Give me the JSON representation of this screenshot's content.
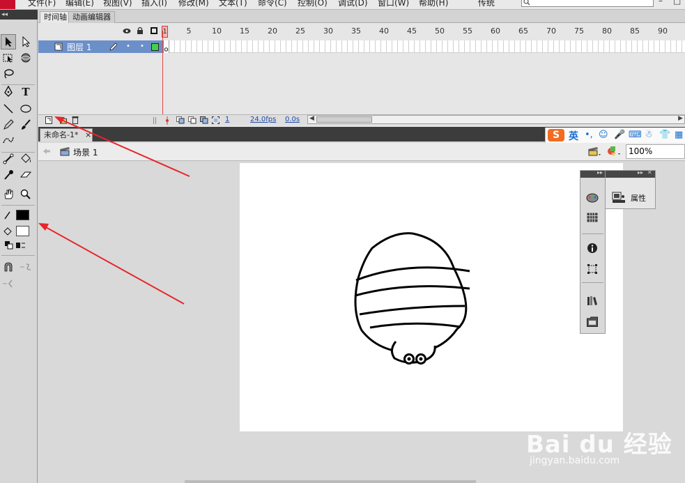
{
  "menu": {
    "items": [
      "文件(F)",
      "编辑(E)",
      "视图(V)",
      "插入(I)",
      "修改(M)",
      "文本(T)",
      "命令(C)",
      "控制(O)",
      "调试(D)",
      "窗口(W)",
      "帮助(H)"
    ],
    "workspace": "传统",
    "window_buttons": [
      "–",
      "□"
    ]
  },
  "tools_panel": {
    "collapse_glyph": "◂◂"
  },
  "timeline": {
    "tabs": [
      "时间轴",
      "动画编辑器"
    ],
    "layer_name": "图层 1",
    "frame_numbers": [
      "5",
      "10",
      "15",
      "20",
      "25",
      "30",
      "35",
      "40",
      "45",
      "50",
      "55",
      "60",
      "65",
      "70",
      "75",
      "80",
      "85",
      "90"
    ],
    "first_frame": "1",
    "current_frame": "1",
    "fps": "24.0fps",
    "time": "0.0s"
  },
  "document": {
    "tab_title": "未命名-1*",
    "tab_close": "×",
    "scene": "场景 1",
    "zoom": "100%"
  },
  "ime": {
    "logo": "S",
    "lang": "英",
    "symbols": [
      "•,",
      "☺",
      "🎤",
      "⌨",
      "☃",
      "👕",
      "▦"
    ]
  },
  "panels": {
    "properties_label": "属性"
  },
  "watermark": {
    "brand": "Bai du 经验",
    "url": "jingyan.baidu.com"
  },
  "colors": {
    "annotation_arrow": "#e8252b",
    "layer_highlight": "#6b8fc9",
    "playhead": "#e24444",
    "stroke_color": "#000000",
    "fill_color": "#ffffff"
  },
  "icons": [
    "selection-tool-icon",
    "subselection-tool-icon",
    "free-transform-icon",
    "3d-rotation-icon",
    "lasso-icon",
    "pen-tool-icon",
    "text-tool-icon",
    "line-tool-icon",
    "oval-tool-icon",
    "pencil-tool-icon",
    "brush-tool-icon",
    "deco-tool-icon",
    "bone-tool-icon",
    "paint-bucket-icon",
    "eyedropper-icon",
    "eraser-icon",
    "hand-tool-icon",
    "zoom-tool-icon"
  ]
}
